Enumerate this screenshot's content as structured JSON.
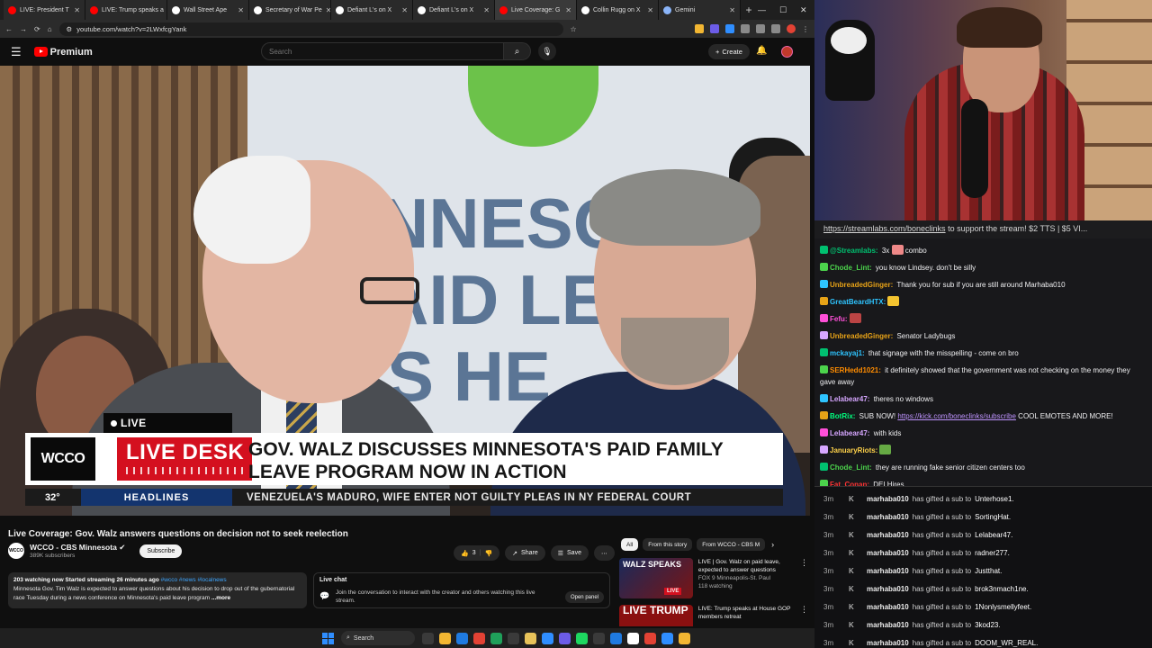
{
  "browser": {
    "tabs": [
      {
        "label": "LIVE: President T",
        "color": "#ff0000"
      },
      {
        "label": "LIVE: Trump speaks a",
        "color": "#ff0000"
      },
      {
        "label": "Wall Street Ape",
        "color": "#ffffff"
      },
      {
        "label": "Secretary of War Pe",
        "color": "#ffffff"
      },
      {
        "label": "Defiant L's on X",
        "color": "#ffffff"
      },
      {
        "label": "Defiant L's on X",
        "color": "#ffffff"
      },
      {
        "label": "Live Coverage: G",
        "color": "#ff0000",
        "active": true
      },
      {
        "label": "Collin Rugg on X",
        "color": "#ffffff"
      },
      {
        "label": "Gemini",
        "color": "#8ab4f8"
      }
    ],
    "url": "youtube.com/watch?v=2LWxfcgYank"
  },
  "youtube": {
    "logo_text": "Premium",
    "search_placeholder": "Search",
    "create_label": "Create"
  },
  "video": {
    "banner_lines": [
      "NNESO",
      "AID LEA",
      "S HE"
    ],
    "live_label": "LIVE",
    "station_logo": "WCCO",
    "segment_label": "LIVE DESK",
    "headline": "GOV. WALZ DISCUSSES MINNESOTA'S PAID FAMILY LEAVE PROGRAM NOW IN ACTION",
    "temperature": "32°",
    "ticker_label": "HEADLINES",
    "ticker_text": "VENEZUELA'S MADURO, WIFE ENTER NOT GUILTY PLEAS IN NY FEDERAL COURT"
  },
  "watch": {
    "title": "Live Coverage: Gov. Walz answers questions on decision not to seek reelection",
    "channel_avatar": "WCCO",
    "channel_name": "WCCO - CBS Minnesota",
    "subscribers": "389K subscribers",
    "subscribe_label": "Subscribe",
    "likes": "3",
    "share_label": "Share",
    "save_label": "Save",
    "desc_stats": "203 watching now  Started streaming 26 minutes ago",
    "desc_tags": "#wcco #news #localnews",
    "desc_text": "Minnesota Gov. Tim Walz is expected to answer questions about his decision to drop out of the gubernatorial race Tuesday during a news conference on Minnesota's paid leave program",
    "more_label": "...more",
    "live_chat_title": "Live chat",
    "live_chat_desc": "Join the conversation to interact with the creator and others watching this live stream.",
    "open_panel_label": "Open panel",
    "chips": [
      "All",
      "From this story",
      "From WCCO - CBS M"
    ],
    "recs": [
      {
        "thumb_text": "WALZ SPEAKS",
        "thumb_live": "LIVE",
        "title": "LIVE | Gov. Walz on paid leave, expected to answer questions",
        "channel": "FOX 9 Minneapolis-St. Paul",
        "meta": "118 watching"
      },
      {
        "thumb_text": "LIVE TRUMP",
        "title": "LIVE: Trump speaks at House GOP members retreat",
        "channel": "",
        "meta": ""
      }
    ]
  },
  "stream": {
    "banner_link": "https://streamlabs.com/boneclinks",
    "banner_rest": " to support the stream! $2 TTS | $5 VI..."
  },
  "chat": [
    {
      "user": "@Streamlabs:",
      "color": "#00c070",
      "text": "3x",
      "tail": "combo",
      "emote": "#e88"
    },
    {
      "user": "Chode_Lint:",
      "color": "#4cd34c",
      "text": "you know Lindsey. don't be silly"
    },
    {
      "user": "UnbreadedGinger:",
      "color": "#e8a317",
      "text": "Thank you for sub if you are still around Marhaba010"
    },
    {
      "user": "GreatBeardHTX:",
      "color": "#2ec4ff",
      "text": "",
      "emote": "#f4c430"
    },
    {
      "user": "Fefu:",
      "color": "#ff4fd8",
      "text": "",
      "emote": "#b44"
    },
    {
      "user": "UnbreadedGinger:",
      "color": "#e8a317",
      "text": "Senator Ladybugs"
    },
    {
      "user": "mckayaj1:",
      "color": "#2ec4ff",
      "text": "that signage with the misspelling - come on bro"
    },
    {
      "user": "SERHedd1021:",
      "color": "#ff8c00",
      "text": "it definitely showed that the government was not checking on the money they gave away"
    },
    {
      "user": "Lelabear47:",
      "color": "#d6a6ff",
      "text": "theres no windows"
    },
    {
      "user": "BotRix:",
      "color": "#00ff7f",
      "text": "SUB NOW!",
      "link": "https://kick.com/boneclinks/subscribe",
      "tail": "COOL EMOTES AND MORE!"
    },
    {
      "user": "Lelabear47:",
      "color": "#d6a6ff",
      "text": "with kids"
    },
    {
      "user": "JanuaryRiots:",
      "color": "#ffd24a",
      "text": "",
      "emote": "#6a4"
    },
    {
      "user": "Chode_Lint:",
      "color": "#4cd34c",
      "text": "they are running fake senior citizen centers too"
    },
    {
      "user": "Fat_Conan:",
      "color": "#ff3333",
      "text": "DEI Hires"
    }
  ],
  "events": {
    "time": "3m",
    "gifter": "marhaba010",
    "verb": "has gifted a sub to",
    "recipients": [
      "Unterhose1.",
      "SortingHat.",
      "Lelabear47.",
      "radner277.",
      "Justthat.",
      "brok3nmach1ne.",
      "1Nonlysmellyfeet.",
      "3kod23.",
      "DOOM_WR_REAL."
    ]
  },
  "taskbar": {
    "search_label": "Search",
    "icon_colors": [
      "#3a3a3a",
      "#f2b632",
      "#1f7ae0",
      "#e34234",
      "#1fa05a",
      "#3a3a3a",
      "#e8c35a",
      "#2f8eff",
      "#6c5ce7",
      "#1ed760",
      "#3a3a3a",
      "#1f7ae0",
      "#ffffff",
      "#e34234",
      "#2f8eff",
      "#f2b632"
    ]
  }
}
